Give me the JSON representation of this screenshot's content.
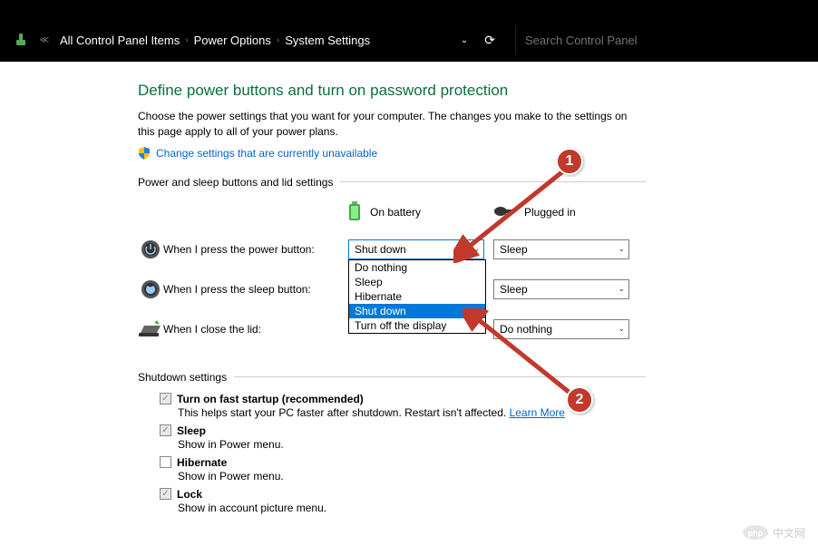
{
  "breadcrumb": {
    "item0": "All Control Panel Items",
    "item1": "Power Options",
    "item2": "System Settings"
  },
  "search": {
    "placeholder": "Search Control Panel"
  },
  "page": {
    "title": "Define power buttons and turn on password protection",
    "description": "Choose the power settings that you want for your computer. The changes you make to the settings on this page apply to all of your power plans.",
    "change_link": "Change settings that are currently unavailable"
  },
  "section1": {
    "legend": "Power and sleep buttons and lid settings",
    "col_battery": "On battery",
    "col_plugged": "Plugged in",
    "row_power": {
      "label": "When I press the power button:",
      "battery": "Shut down",
      "plugged": "Sleep"
    },
    "row_sleep": {
      "label": "When I press the sleep button:",
      "battery": "",
      "plugged": "Sleep"
    },
    "row_lid": {
      "label": "When I close the lid:",
      "battery": "",
      "plugged": "Do nothing"
    },
    "dropdown": {
      "opt0": "Do nothing",
      "opt1": "Sleep",
      "opt2": "Hibernate",
      "opt3": "Shut down",
      "opt4": "Turn off the display"
    }
  },
  "section2": {
    "legend": "Shutdown settings",
    "fast": {
      "title": "Turn on fast startup (recommended)",
      "sub": "This helps start your PC faster after shutdown. Restart isn't affected.",
      "link": "Learn More"
    },
    "sleep": {
      "title": "Sleep",
      "sub": "Show in Power menu."
    },
    "hibernate": {
      "title": "Hibernate",
      "sub": "Show in Power menu."
    },
    "lock": {
      "title": "Lock",
      "sub": "Show in account picture menu."
    }
  },
  "annotations": {
    "b1": "1",
    "b2": "2"
  },
  "watermark": "中文网"
}
